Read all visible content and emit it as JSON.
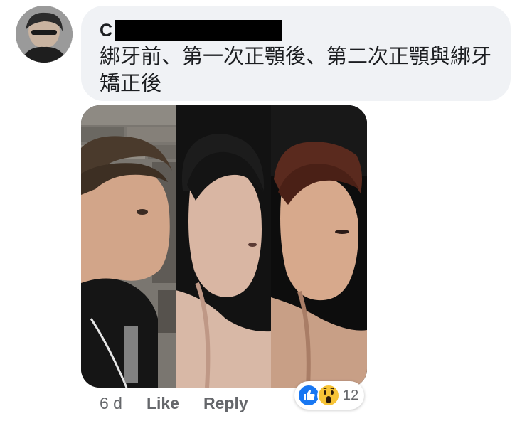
{
  "comment": {
    "author_initial": "C",
    "author_name_redacted": true,
    "text": "綁牙前、第一次正顎後、第二次正顎與綁牙矯正後",
    "timestamp": "6 d",
    "like_label": "Like",
    "reply_label": "Reply",
    "reaction_count": "12",
    "reaction_icons": [
      "like-icon",
      "wow-icon"
    ]
  },
  "colors": {
    "bubble_bg": "#f0f2f5",
    "like_blue": "#1877f2",
    "wow_yellow": "#f7c437",
    "meta_gray": "#65676b"
  }
}
